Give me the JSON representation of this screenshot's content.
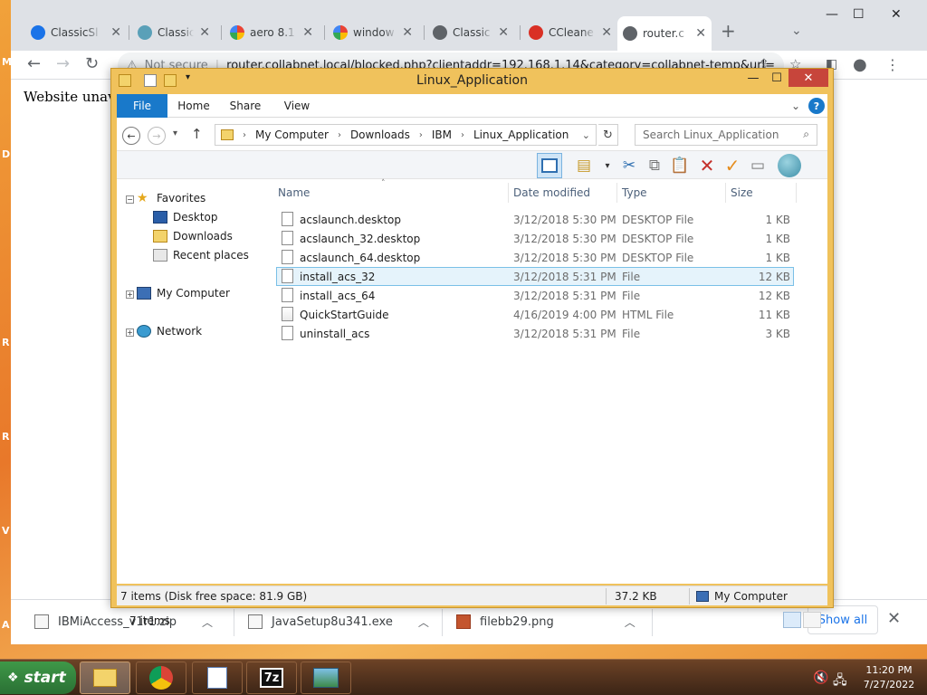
{
  "desktop": {
    "edge_labels": [
      "M",
      "D",
      "R",
      "R",
      "V",
      "A"
    ]
  },
  "chrome": {
    "tabs": [
      {
        "title": "ClassicSl",
        "icon": "classicshell-icon",
        "color": "#1a73e8"
      },
      {
        "title": "Classic S",
        "icon": "shell-icon",
        "color": "#5aa0b8"
      },
      {
        "title": "aero 8.1",
        "icon": "google-icon",
        "color": "#4285f4"
      },
      {
        "title": "window",
        "icon": "google-icon",
        "color": "#4285f4"
      },
      {
        "title": "Classic S",
        "icon": "globe-icon",
        "color": "#5f6368"
      },
      {
        "title": "CCleane",
        "icon": "ccleaner-icon",
        "color": "#d93025"
      },
      {
        "title": "router.c",
        "icon": "globe-icon",
        "color": "#5f6368"
      }
    ],
    "omnibox": {
      "security": "Not secure",
      "url": "router.collabnet.local/blocked.php?clientaddr=192.168.1.14&category=collabnet-temp&url="
    },
    "page_text": "Website unavai",
    "downloads": [
      {
        "name": "IBMiAccess_v1r1.zip",
        "icon": "zip-file-icon"
      },
      {
        "name": "JavaSetup8u341.exe",
        "icon": "exe-file-icon"
      },
      {
        "name": "filebb29.png",
        "icon": "png-file-icon"
      }
    ],
    "show_all": "Show all"
  },
  "explorer": {
    "title": "Linux_Application",
    "ribbon_tabs": [
      "File",
      "Home",
      "Share",
      "View"
    ],
    "breadcrumb": [
      "My Computer",
      "Downloads",
      "IBM",
      "Linux_Application"
    ],
    "search_placeholder": "Search Linux_Application",
    "nav": {
      "favorites": "Favorites",
      "favorites_items": [
        "Desktop",
        "Downloads",
        "Recent places"
      ],
      "computer": "My Computer",
      "network": "Network"
    },
    "columns": {
      "name": "Name",
      "date": "Date modified",
      "type": "Type",
      "size": "Size"
    },
    "files": [
      {
        "name": "acslaunch.desktop",
        "date": "3/12/2018 5:30 PM",
        "type": "DESKTOP File",
        "size": "1 KB"
      },
      {
        "name": "acslaunch_32.desktop",
        "date": "3/12/2018 5:30 PM",
        "type": "DESKTOP File",
        "size": "1 KB"
      },
      {
        "name": "acslaunch_64.desktop",
        "date": "3/12/2018 5:30 PM",
        "type": "DESKTOP File",
        "size": "1 KB"
      },
      {
        "name": "install_acs_32",
        "date": "3/12/2018 5:31 PM",
        "type": "File",
        "size": "12 KB"
      },
      {
        "name": "install_acs_64",
        "date": "3/12/2018 5:31 PM",
        "type": "File",
        "size": "12 KB"
      },
      {
        "name": "QuickStartGuide",
        "date": "4/16/2019 4:00 PM",
        "type": "HTML File",
        "size": "11 KB"
      },
      {
        "name": "uninstall_acs",
        "date": "3/12/2018 5:31 PM",
        "type": "File",
        "size": "3 KB"
      }
    ],
    "selected_file": "install_acs_32",
    "item_count": "7 items",
    "status": {
      "summary": "7 items (Disk free space: 81.9 GB)",
      "size": "37.2 KB",
      "location": "My Computer"
    }
  },
  "taskbar": {
    "start_label": "start",
    "clock_time": "11:20 PM",
    "clock_date": "7/27/2022",
    "sevenzip_label": "7z"
  }
}
